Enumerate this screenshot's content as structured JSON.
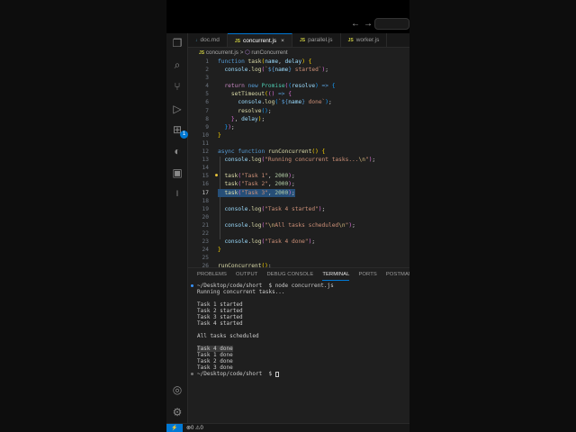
{
  "colors": {
    "accent": "#0078d4",
    "selection": "#264f78",
    "editor_bg": "#1f1f1f"
  },
  "titlebar": {
    "back_icon": "←",
    "forward_icon": "→"
  },
  "activity_bar": {
    "extensions_badge": "1"
  },
  "tabs": [
    {
      "label": "doc.md",
      "icon": "↓"
    },
    {
      "label": "concurrent.js",
      "icon": "JS",
      "close": "×"
    },
    {
      "label": "parallel.js",
      "icon": "JS"
    },
    {
      "label": "worker.js",
      "icon": "JS"
    }
  ],
  "breadcrumb": {
    "icon": "JS",
    "file": "concurrent.js",
    "sep": ">",
    "symbol": "runConcurrent"
  },
  "editor": {
    "current_line": 17,
    "lines": [
      [
        [
          "function",
          "k"
        ],
        [
          " ",
          "t"
        ],
        [
          "task",
          "f"
        ],
        [
          "(",
          "b1"
        ],
        [
          "name",
          "p"
        ],
        [
          ", ",
          "t"
        ],
        [
          "delay",
          "p"
        ],
        [
          ")",
          "b1"
        ],
        [
          " ",
          "t"
        ],
        [
          "{",
          "b1"
        ]
      ],
      [
        [
          "  console",
          "p"
        ],
        [
          ".",
          "t"
        ],
        [
          "log",
          "f"
        ],
        [
          "(",
          "b2"
        ],
        [
          "`",
          "s"
        ],
        [
          "${",
          "k"
        ],
        [
          "name",
          "p"
        ],
        [
          "}",
          "k"
        ],
        [
          " started`",
          "s"
        ],
        [
          ")",
          "b2"
        ],
        [
          ";",
          "t"
        ]
      ],
      [],
      [
        [
          "  return",
          "kc"
        ],
        [
          " ",
          "t"
        ],
        [
          "new",
          "k"
        ],
        [
          " ",
          "t"
        ],
        [
          "Promise",
          "c"
        ],
        [
          "(",
          "b2"
        ],
        [
          "(",
          "b3"
        ],
        [
          "resolve",
          "p"
        ],
        [
          ")",
          "b3"
        ],
        [
          " => ",
          "k"
        ],
        [
          "{",
          "b3"
        ]
      ],
      [
        [
          "    setTimeout",
          "f"
        ],
        [
          "(",
          "b1"
        ],
        [
          "()",
          "b2"
        ],
        [
          " => ",
          "k"
        ],
        [
          "{",
          "b2"
        ]
      ],
      [
        [
          "      console",
          "p"
        ],
        [
          ".",
          "t"
        ],
        [
          "log",
          "f"
        ],
        [
          "(",
          "b3"
        ],
        [
          "`",
          "s"
        ],
        [
          "${",
          "k"
        ],
        [
          "name",
          "p"
        ],
        [
          "}",
          "k"
        ],
        [
          " done`",
          "s"
        ],
        [
          ")",
          "b3"
        ],
        [
          ";",
          "t"
        ]
      ],
      [
        [
          "      resolve",
          "f"
        ],
        [
          "()",
          "b3"
        ],
        [
          ";",
          "t"
        ]
      ],
      [
        [
          "    }",
          "b2"
        ],
        [
          ", ",
          "t"
        ],
        [
          "delay",
          "p"
        ],
        [
          ")",
          "b1"
        ],
        [
          ";",
          "t"
        ]
      ],
      [
        [
          "  }",
          "b3"
        ],
        [
          ")",
          "b2"
        ],
        [
          ";",
          "t"
        ]
      ],
      [
        [
          "}",
          "b1"
        ]
      ],
      [],
      [
        [
          "async",
          "k"
        ],
        [
          " ",
          "t"
        ],
        [
          "function",
          "k"
        ],
        [
          " ",
          "t"
        ],
        [
          "runConcurrent",
          "f"
        ],
        [
          "()",
          "b1"
        ],
        [
          " ",
          "t"
        ],
        [
          "{",
          "b1"
        ]
      ],
      [
        [
          "  console",
          "p"
        ],
        [
          ".",
          "t"
        ],
        [
          "log",
          "f"
        ],
        [
          "(",
          "b2"
        ],
        [
          "\"Running concurrent tasks...",
          "s"
        ],
        [
          "\\n",
          "e"
        ],
        [
          "\"",
          "s"
        ],
        [
          ")",
          "b2"
        ],
        [
          ";",
          "t"
        ]
      ],
      [],
      [
        [
          "  task",
          "f"
        ],
        [
          "(",
          "b2"
        ],
        [
          "\"Task 1\"",
          "s"
        ],
        [
          ", ",
          "t"
        ],
        [
          "2000",
          "n"
        ],
        [
          ")",
          "b2"
        ],
        [
          ";",
          "t"
        ]
      ],
      [
        [
          "  task",
          "f"
        ],
        [
          "(",
          "b2"
        ],
        [
          "\"Task 2\"",
          "s"
        ],
        [
          ", ",
          "t"
        ],
        [
          "2000",
          "n"
        ],
        [
          ")",
          "b2"
        ],
        [
          ";",
          "t"
        ]
      ],
      [
        [
          "  task",
          "f"
        ],
        [
          "(",
          "b2"
        ],
        [
          "\"Task 3\"",
          "s"
        ],
        [
          ", ",
          "t"
        ],
        [
          "2000",
          "n"
        ],
        [
          ")",
          "b2"
        ],
        [
          ";",
          "t"
        ]
      ],
      [],
      [
        [
          "  console",
          "p"
        ],
        [
          ".",
          "t"
        ],
        [
          "log",
          "f"
        ],
        [
          "(",
          "b2"
        ],
        [
          "\"Task 4 started\"",
          "s"
        ],
        [
          ")",
          "b2"
        ],
        [
          ";",
          "t"
        ]
      ],
      [],
      [
        [
          "  console",
          "p"
        ],
        [
          ".",
          "t"
        ],
        [
          "log",
          "f"
        ],
        [
          "(",
          "b2"
        ],
        [
          "\"",
          "s"
        ],
        [
          "\\n",
          "e"
        ],
        [
          "All tasks scheduled",
          "s"
        ],
        [
          "\\n",
          "e"
        ],
        [
          "\"",
          "s"
        ],
        [
          ")",
          "b2"
        ],
        [
          ";",
          "t"
        ]
      ],
      [],
      [
        [
          "  console",
          "p"
        ],
        [
          ".",
          "t"
        ],
        [
          "log",
          "f"
        ],
        [
          "(",
          "b2"
        ],
        [
          "\"Task 4 done\"",
          "s"
        ],
        [
          ")",
          "b2"
        ],
        [
          ";",
          "t"
        ]
      ],
      [
        [
          "}",
          "b1"
        ]
      ],
      [],
      [
        [
          "runConcurrent",
          "f"
        ],
        [
          "()",
          "b1"
        ],
        [
          ";",
          "t"
        ]
      ]
    ]
  },
  "panel": {
    "tabs": [
      "PROBLEMS",
      "OUTPUT",
      "DEBUG CONSOLE",
      "TERMINAL",
      "PORTS",
      "POSTMAN"
    ],
    "active_tab": "TERMINAL",
    "terminal": [
      {
        "text": "~/Desktop/code/short  $ node concurrent.js",
        "dot": "#3794ff"
      },
      {
        "text": "Running concurrent tasks..."
      },
      {
        "text": ""
      },
      {
        "text": "Task 1 started"
      },
      {
        "text": "Task 2 started"
      },
      {
        "text": "Task 3 started"
      },
      {
        "text": "Task 4 started"
      },
      {
        "text": ""
      },
      {
        "text": "All tasks scheduled"
      },
      {
        "text": ""
      },
      {
        "text": "Task 4 done",
        "highlight": true
      },
      {
        "text": "Task 1 done"
      },
      {
        "text": "Task 2 done"
      },
      {
        "text": "Task 3 done"
      },
      {
        "text": "~/Desktop/code/short  $ ",
        "dot": "#777",
        "cursor": true
      }
    ]
  },
  "status": {
    "remote_icon": "⚡",
    "errors": "0",
    "warnings": "0",
    "error_icon": "⊗",
    "warning_icon": "⚠"
  }
}
